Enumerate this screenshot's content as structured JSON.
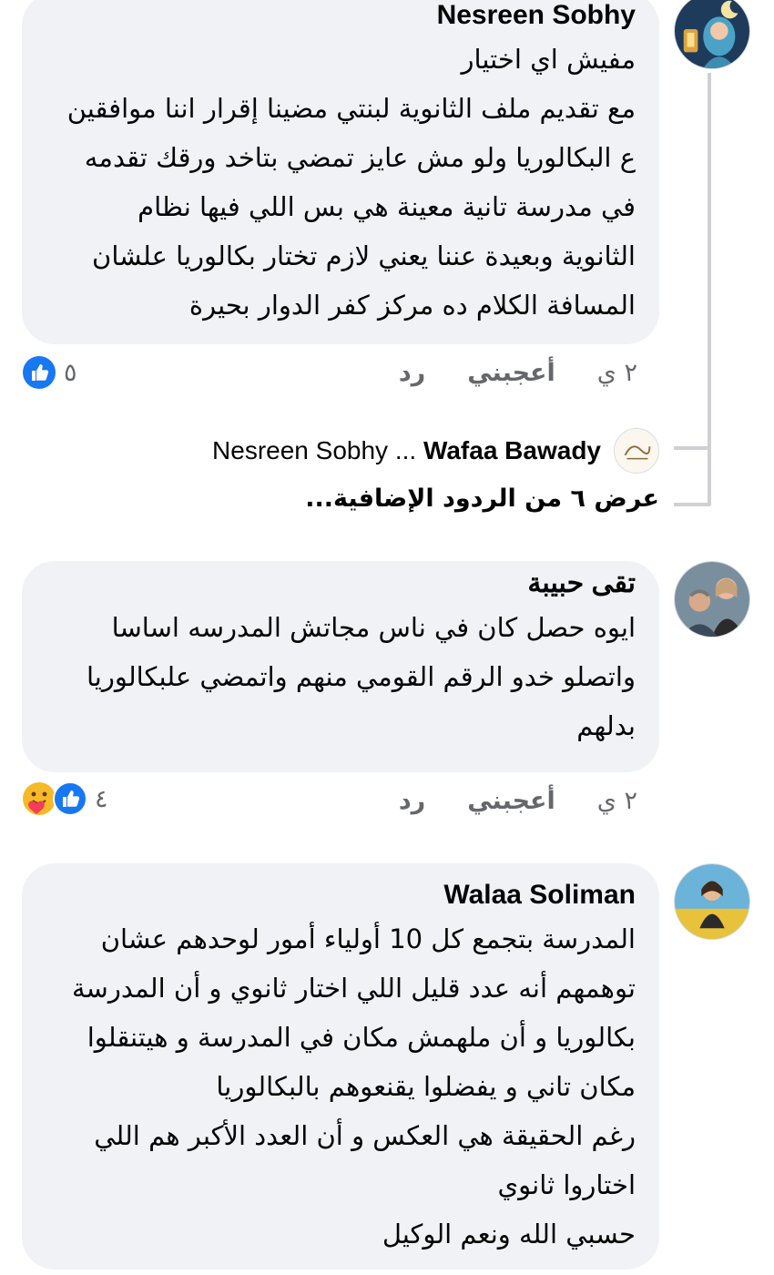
{
  "comments": [
    {
      "author": "Nesreen Sobhy",
      "avatar": "nesreen-avatar",
      "text": "مفيش اي اختيار\nمع تقديم ملف الثانوية لبنتي مضينا إقرار اننا موافقين\nع البكالوريا ولو مش عايز تمضي بتاخد ورقك تقدمه\nفي مدرسة تانية معينة هي بس اللي فيها نظام\nالثانوية وبعيدة عننا يعني لازم تختار بكالوريا علشان\nالمسافة الكلام ده مركز كفر الدوار بحيرة",
      "time": "٢ ي",
      "like_label": "أعجبني",
      "reply_label": "رد",
      "reaction_count": "٥"
    },
    {
      "author": "تقى حبيبة",
      "avatar": "taqa-avatar",
      "text": "ايوه حصل كان في ناس مجاتش المدرسه اساسا\nواتصلو خدو الرقم القومي منهم واتمضي علبكالوريا\nبدلهم",
      "time": "٢ ي",
      "like_label": "أعجبني",
      "reply_label": "رد",
      "reaction_count": "٤"
    },
    {
      "author": "Walaa Soliman",
      "avatar": "walaa-avatar",
      "text": "المدرسة بتجمع كل 10 أولياء أمور لوحدهم عشان\nتوهمهم أنه عدد قليل اللي اختار ثانوي و أن المدرسة\nبكالوريا و أن ملهمش مكان في المدرسة و هيتنقلوا\nمكان تاني و يفضلوا يقنعوهم بالبكالوريا\nرغم الحقيقة هي العكس و أن العدد الأكبر هم اللي\nاختاروا ثانوي\nحسبي الله ونعم الوكيل"
    }
  ],
  "reply_preview": {
    "author": "Wafaa Bawady",
    "separator": "...",
    "mention": "Nesreen Sobhy"
  },
  "more_replies_label": "عرض ٦ من الردود الإضافية...",
  "colors": {
    "bubble": "#f0f2f5",
    "like_blue": "#1877f2",
    "meta_gray": "#65676b",
    "care_yellow": "#f7b928"
  }
}
